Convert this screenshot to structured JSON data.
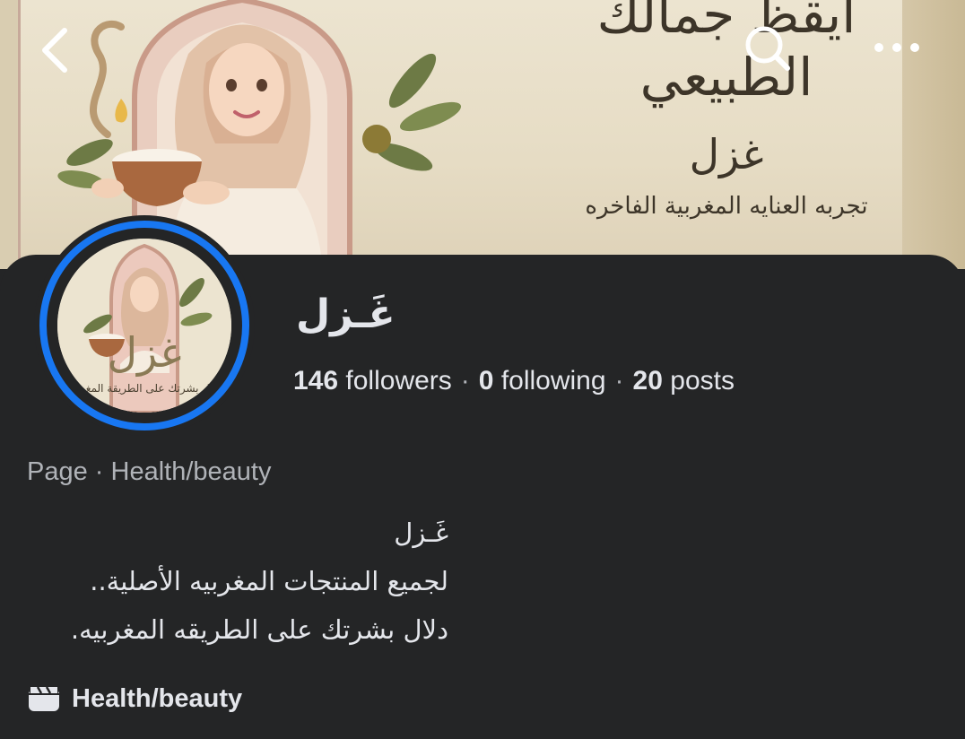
{
  "cover": {
    "heading": "ايقظ جمالك الطبيعي",
    "brand": "غزل",
    "tagline": "تجربه العنايه المغربية الفاخره"
  },
  "topbar": {
    "back_icon": "chevron-left-icon",
    "search_icon": "search-icon",
    "more_icon": "more-horizontal-icon"
  },
  "profile": {
    "name": "غَـزل",
    "avatar_brand": "غزل",
    "avatar_tagline": "دلال بشرتك على الطريقة المغربية",
    "stats": {
      "followers_count": "146",
      "followers_label": "followers",
      "following_count": "0",
      "following_label": "following",
      "posts_count": "20",
      "posts_label": "posts",
      "separator": "·"
    },
    "category_line": "Page · Health/beauty",
    "bio": [
      "غَـزل",
      "لجميع المنتجات المغربيه الأصلية..",
      "دلال بشرتك على الطريقه المغربيه."
    ],
    "info": {
      "icon": "clapperboard-icon",
      "label": "Health/beauty"
    }
  },
  "colors": {
    "background": "#242526",
    "text": "#e4e6eb",
    "muted": "#b0b3b8",
    "accent": "#1877f2"
  }
}
